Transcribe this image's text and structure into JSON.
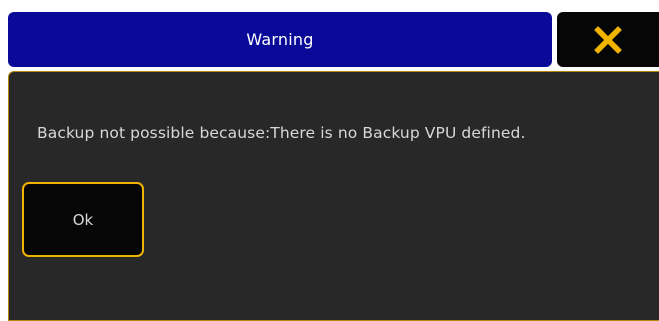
{
  "dialog": {
    "title": "Warning",
    "close_icon": "close-x-icon",
    "message": "Backup not possible because:There is no Backup VPU defined.",
    "ok_label": "Ok"
  },
  "colors": {
    "titlebar": "#0a0a99",
    "panel": "#282828",
    "accent": "#f0b400",
    "button_bg": "#060606",
    "text": "#d8d8d8"
  }
}
